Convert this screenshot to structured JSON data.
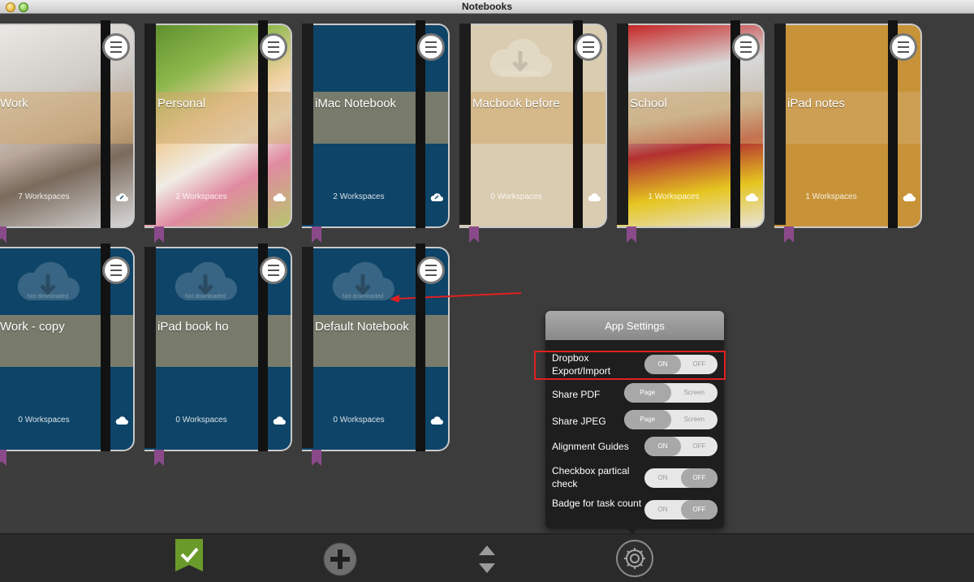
{
  "window": {
    "title": "Notebooks"
  },
  "notebooks": [
    {
      "name": "Work",
      "workspaces": "7 Workspaces"
    },
    {
      "name": "Personal",
      "workspaces": "2 Workspaces"
    },
    {
      "name": "iMac Notebook",
      "workspaces": "2 Workspaces"
    },
    {
      "name": "Macbook before",
      "workspaces": "0 Workspaces",
      "download_status": "Not downloaded"
    },
    {
      "name": "School",
      "workspaces": "1 Workspaces"
    },
    {
      "name": "iPad notes",
      "workspaces": "1 Workspaces"
    },
    {
      "name": "Work - copy",
      "workspaces": "0 Workspaces",
      "download_status": "Not downloaded"
    },
    {
      "name": "iPad book ho",
      "workspaces": "0 Workspaces",
      "download_status": "Not downloaded"
    },
    {
      "name": "Default Notebook",
      "workspaces": "0 Workspaces",
      "download_status": "Not downloaded"
    }
  ],
  "settings": {
    "title": "App Settings",
    "rows": [
      {
        "label": "Dropbox Export/Import",
        "options": [
          "ON",
          "OFF"
        ],
        "selected": "ON"
      },
      {
        "label": "Share PDF",
        "options": [
          "Page",
          "Screen"
        ],
        "selected": "Page"
      },
      {
        "label": "Share JPEG",
        "options": [
          "Page",
          "Screen"
        ],
        "selected": "Page"
      },
      {
        "label": "Alignment Guides",
        "options": [
          "ON",
          "OFF"
        ],
        "selected": "ON"
      },
      {
        "label": "Checkbox partical check",
        "options": [
          "ON",
          "OFF"
        ],
        "selected": "OFF"
      },
      {
        "label": "Badge for task count",
        "options": [
          "ON",
          "OFF"
        ],
        "selected": "OFF"
      }
    ]
  },
  "toolbar": {
    "icons": [
      "checkmark-bookmark-icon",
      "add-icon",
      "sort-icon",
      "gear-icon"
    ]
  },
  "colors": {
    "highlight": "#e02020",
    "notebook_blue": "#0d4468",
    "ribbon": "#8a4a8a",
    "background": "#3c3c3c"
  }
}
